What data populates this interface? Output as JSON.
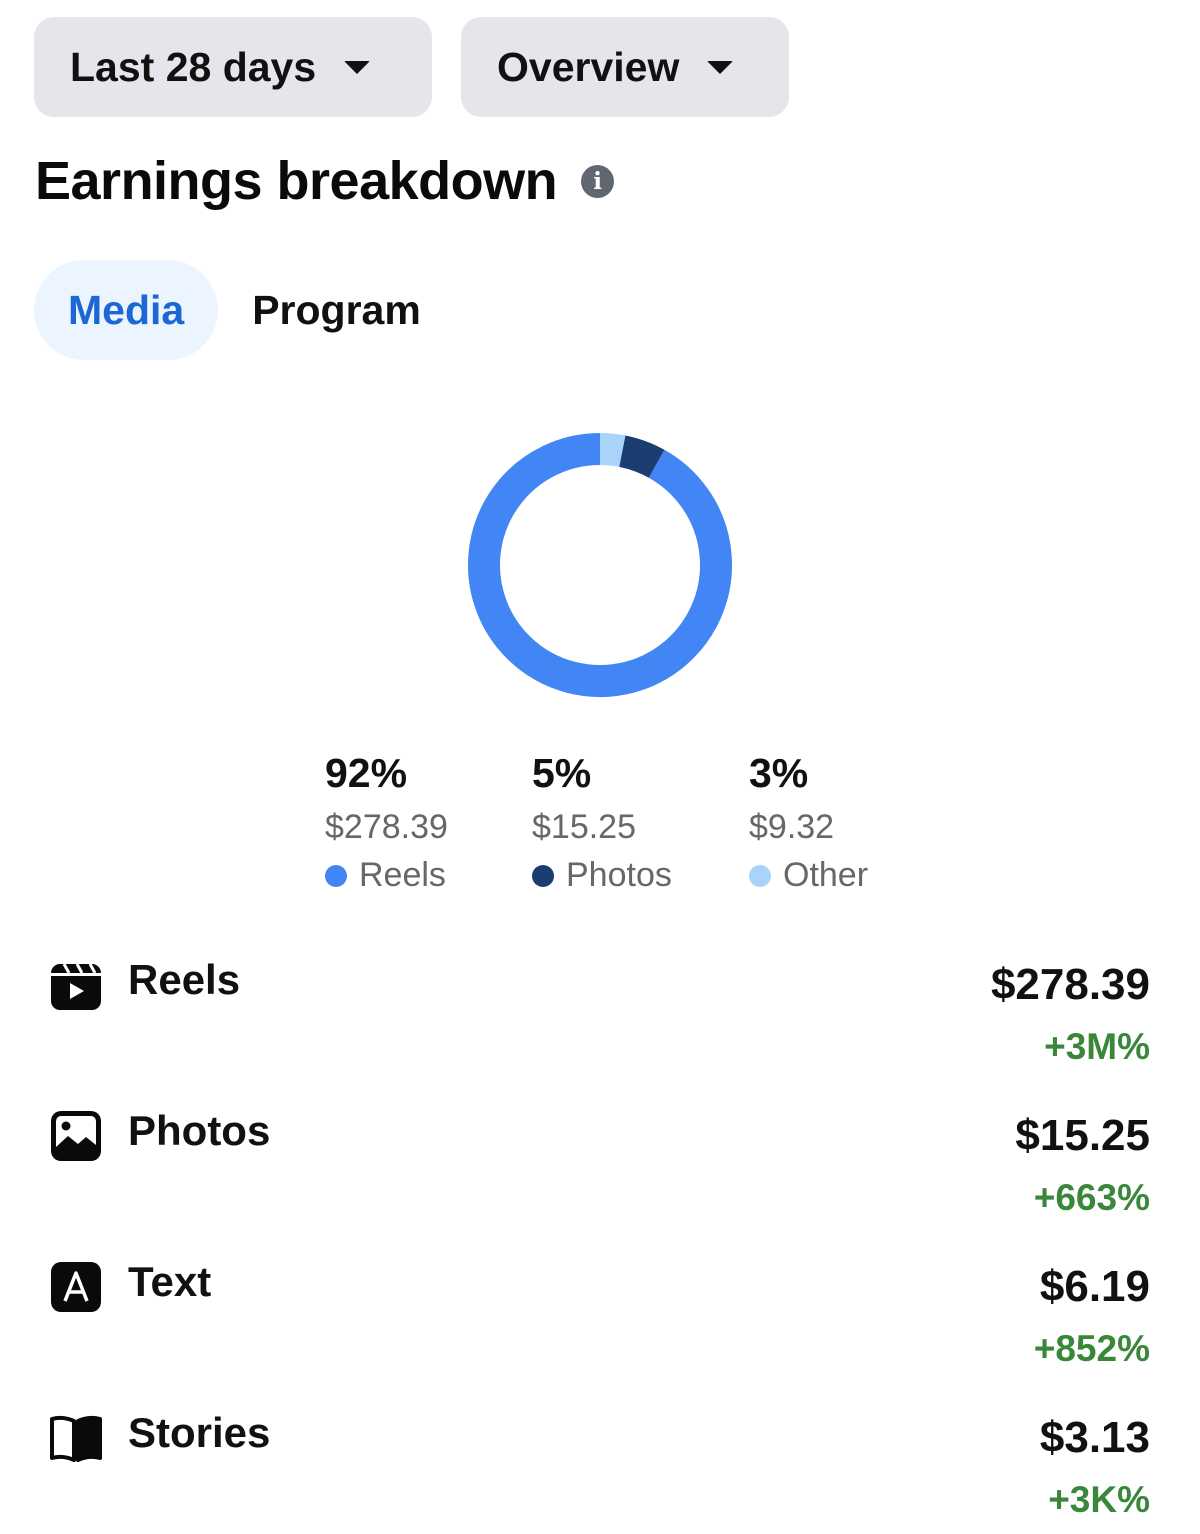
{
  "filters": {
    "date_range": "Last 28 days",
    "view": "Overview"
  },
  "heading": {
    "title": "Earnings breakdown",
    "info_icon": "info-icon"
  },
  "tabs": [
    {
      "label": "Media",
      "active": true
    },
    {
      "label": "Program",
      "active": false
    }
  ],
  "chart_data": {
    "type": "pie",
    "style": "donut",
    "categories": [
      "Reels",
      "Photos",
      "Other"
    ],
    "values": [
      278.39,
      15.25,
      9.32
    ],
    "percent_labels": [
      "92%",
      "5%",
      "3%"
    ],
    "amount_labels": [
      "$278.39",
      "$15.25",
      "$9.32"
    ],
    "colors": [
      "#4285f4",
      "#1b3d72",
      "#a8d4fa"
    ]
  },
  "media": [
    {
      "name": "Reels",
      "icon": "reels-icon",
      "amount": "$278.39",
      "change": "+3M%"
    },
    {
      "name": "Photos",
      "icon": "photo-icon",
      "amount": "$15.25",
      "change": "+663%"
    },
    {
      "name": "Text",
      "icon": "text-icon",
      "amount": "$6.19",
      "change": "+852%"
    },
    {
      "name": "Stories",
      "icon": "book-icon",
      "amount": "$3.13",
      "change": "+3K%"
    }
  ],
  "colors": {
    "positive": "#3a8739",
    "accent": "#1b67d3",
    "tab_active_bg": "#ebf4ff",
    "filter_bg": "#e4e6eb"
  }
}
